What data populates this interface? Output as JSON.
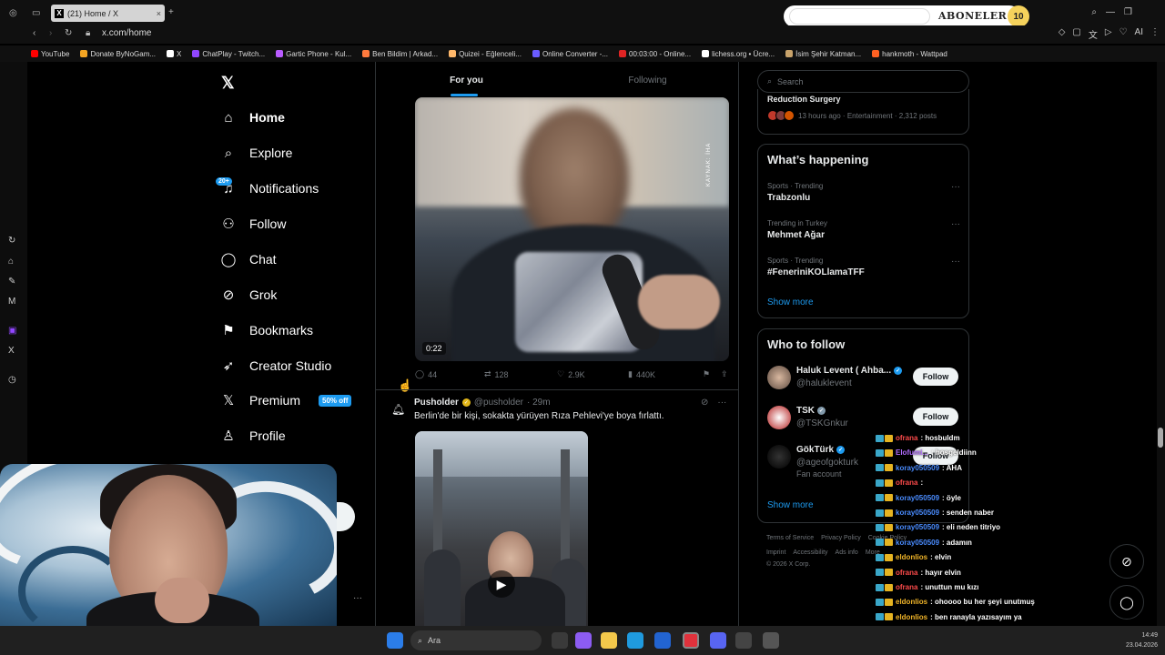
{
  "browser": {
    "tab_title": "(21) Home / X",
    "url": "x.com/home",
    "bookmarks": [
      {
        "label": "YouTube",
        "color": "#ff0000"
      },
      {
        "label": "Donate ByNoGam...",
        "color": "#f5a623"
      },
      {
        "label": "X",
        "color": "#ffffff"
      },
      {
        "label": "ChatPlay - Twitch...",
        "color": "#9146ff"
      },
      {
        "label": "Gartic Phone - Kul...",
        "color": "#b95cff"
      },
      {
        "label": "Ben Bildim | Arkad...",
        "color": "#ff7a3d"
      },
      {
        "label": "Quizei - Eğlenceli...",
        "color": "#ffb86b"
      },
      {
        "label": "Online Converter -...",
        "color": "#6a5cff"
      },
      {
        "label": "00:03:00 - Online...",
        "color": "#e02424"
      },
      {
        "label": "lichess.org • Ücre...",
        "color": "#ffffff"
      },
      {
        "label": "İsim Şehir Katman...",
        "color": "#c8a36b"
      },
      {
        "label": "hankmoth - Wattpad",
        "color": "#ff6122"
      }
    ]
  },
  "overlay": {
    "aboneler_label": "ABONELER",
    "aboneler_count": "10"
  },
  "nav": {
    "items": [
      {
        "label": "Home",
        "icon": "home-icon"
      },
      {
        "label": "Explore",
        "icon": "search-icon"
      },
      {
        "label": "Notifications",
        "icon": "bell-icon"
      },
      {
        "label": "Follow",
        "icon": "follow-icon"
      },
      {
        "label": "Chat",
        "icon": "chat-icon"
      },
      {
        "label": "Grok",
        "icon": "grok-icon"
      },
      {
        "label": "Bookmarks",
        "icon": "bookmark-icon"
      },
      {
        "label": "Creator Studio",
        "icon": "rocket-icon"
      },
      {
        "label": "Premium",
        "icon": "x-icon"
      },
      {
        "label": "Profile",
        "icon": "person-icon"
      }
    ],
    "notifications_badge": "20+",
    "premium_promo": "50% off"
  },
  "timeline": {
    "tabs": [
      "For you",
      "Following"
    ],
    "post1": {
      "video_duration": "0:22",
      "watermark": "KAYNAK: İHA",
      "replies": "44",
      "reposts": "128",
      "likes": "2.9K",
      "views": "440K"
    },
    "post2": {
      "name": "Pusholder",
      "handle": "@pusholder",
      "time": "· 29m",
      "text": "Berlin'de bir kişi, sokakta yürüyen Rıza Pehlevi'ye boya fırlattı."
    }
  },
  "sidebar": {
    "search_placeholder": "Search",
    "top_trend": {
      "title": "Reduction Surgery",
      "meta": "13 hours ago · Entertainment · 2,312 posts"
    },
    "happening": {
      "title": "What’s happening",
      "trends": [
        {
          "meta": "Sports · Trending",
          "name": "Trabzonlu"
        },
        {
          "meta": "Trending in Turkey",
          "name": "Mehmet Ağar"
        },
        {
          "meta": "Sports · Trending",
          "name": "#FeneriniKOLlamaTFF"
        }
      ],
      "show_more": "Show more"
    },
    "who_to_follow": {
      "title": "Who to follow",
      "accounts": [
        {
          "name": "Haluk Levent ( Ahba...",
          "handle": "@haluklevent",
          "badge": "blue",
          "button": "Follow"
        },
        {
          "name": "TSK",
          "handle": "@TSKGnkur",
          "badge": "gray",
          "button": "Follow"
        },
        {
          "name": "GökTürk",
          "handle": "@ageofgokturk",
          "extra": "Fan account",
          "badge": "blue",
          "button": "Follow"
        }
      ],
      "show_more": "Show more"
    },
    "footer": {
      "row1": [
        "Terms of Service",
        "Privacy Policy",
        "Cookie Policy"
      ],
      "row2": [
        "Imprint",
        "Accessibility",
        "Ads info",
        "More"
      ],
      "copyright": "© 2026 X Corp."
    }
  },
  "chat": [
    {
      "user": "ofrana",
      "color": "#ff4b4b",
      "msg": ": hosbuldm"
    },
    {
      "user": "Elofumi...",
      "color": "#b16cff",
      "msg": ": hosgeldiinn"
    },
    {
      "user": "koray050509",
      "color": "#4a8cff",
      "msg": ": AHA"
    },
    {
      "user": "ofrana",
      "color": "#ff4b4b",
      "msg": ": "
    },
    {
      "user": "koray050509",
      "color": "#4a8cff",
      "msg": ": öyle"
    },
    {
      "user": "koray050509",
      "color": "#4a8cff",
      "msg": ": senden naber"
    },
    {
      "user": "koray050509",
      "color": "#4a8cff",
      "msg": ": eli neden titriyo"
    },
    {
      "user": "koray050509",
      "color": "#4a8cff",
      "msg": ": adamın"
    },
    {
      "user": "eldonlios",
      "color": "#f0b429",
      "msg": ": elvin"
    },
    {
      "user": "ofrana",
      "color": "#ff4b4b",
      "msg": ": hayır elvin"
    },
    {
      "user": "ofrana",
      "color": "#ff4b4b",
      "msg": ": unuttun mu kızı"
    },
    {
      "user": "eldonlios",
      "color": "#f0b429",
      "msg": ": ohoooo bu her şeyi unutmuş"
    },
    {
      "user": "eldonlios",
      "color": "#f0b429",
      "msg": ": ben ranayla yazısayım ya"
    },
    {
      "user": "eldonlios",
      "color": "#f0b429",
      "msg": ": naber rana"
    },
    {
      "user": "ofrana",
      "color": "#ff4b4b",
      "msg": ": selam cnm"
    }
  ],
  "taskbar": {
    "search_label": "Ara",
    "time": "14:49",
    "date": "23.04.2026"
  }
}
